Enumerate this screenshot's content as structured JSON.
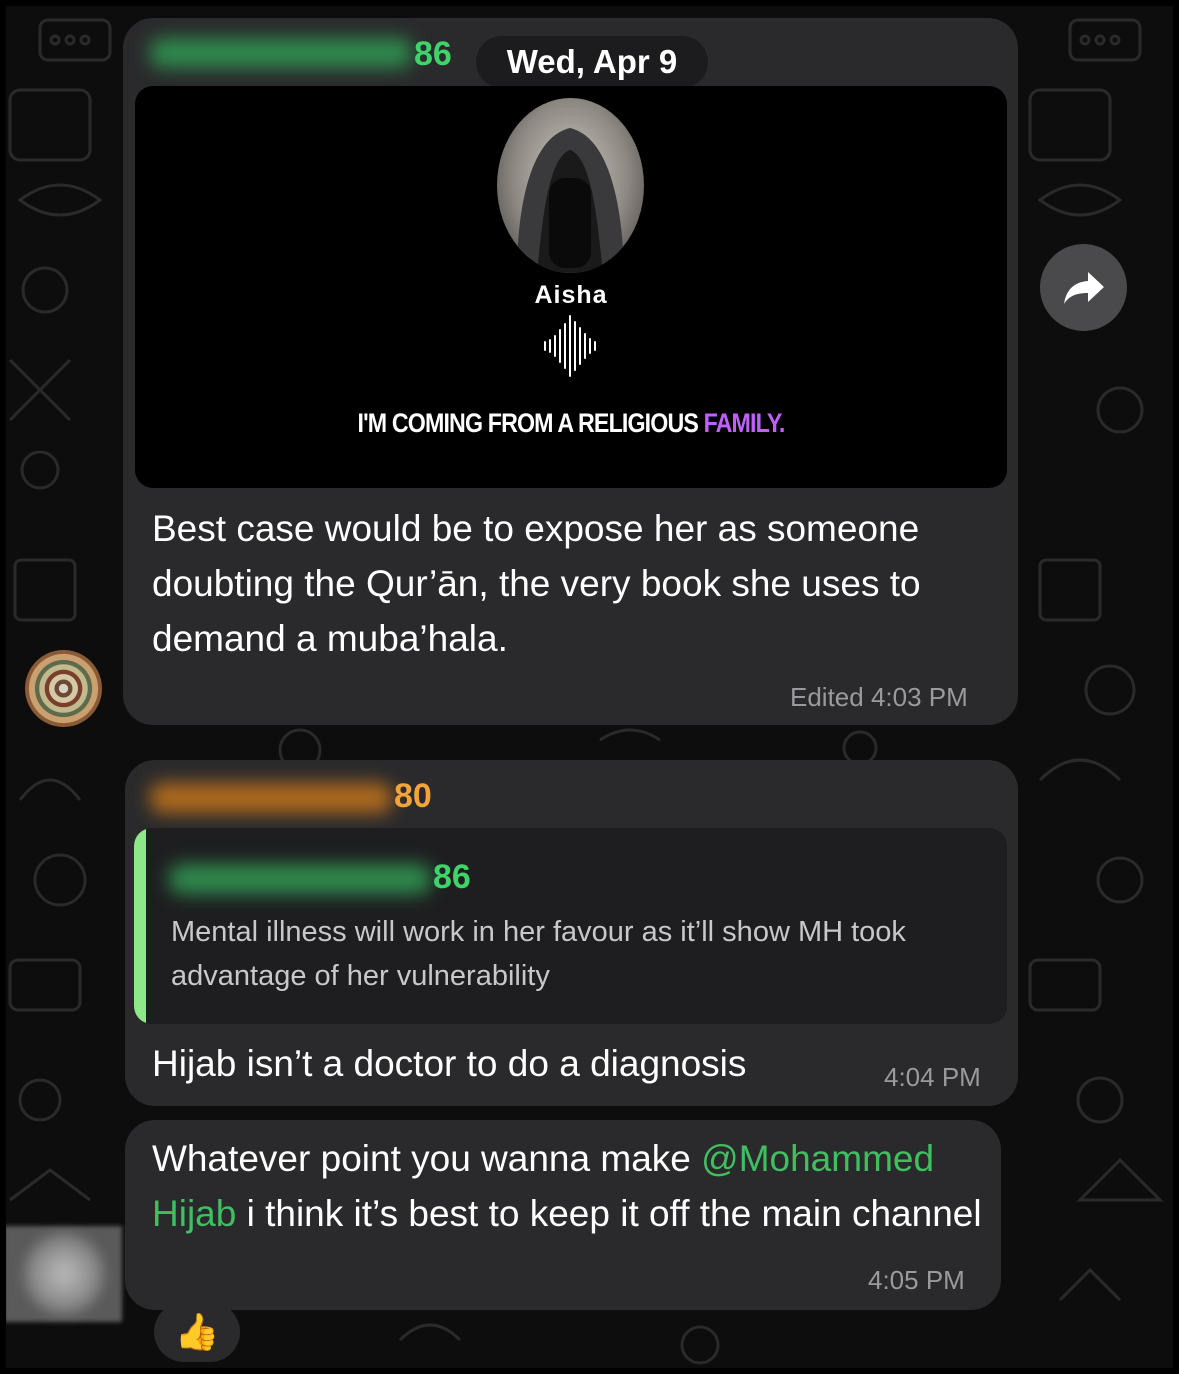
{
  "date_separator": "Wed, Apr 9",
  "messages": [
    {
      "sender_suffix": "86",
      "media": {
        "name": "Aisha",
        "caption_main": "I'M COMING FROM A RELIGIOUS ",
        "caption_highlight": "FAMILY."
      },
      "text": "Best case would be to expose her as someone doubting the Qur’ān, the very book she uses to demand a muba’hala.",
      "edited_label": "Edited",
      "time": "4:03 PM"
    },
    {
      "sender_suffix": "80",
      "reply": {
        "sender_suffix": "86",
        "text": "Mental illness will work in her favour as it’ll show MH took advantage of her vulnerability"
      },
      "text": "Hijab isn’t a doctor to do a diagnosis",
      "time": "4:04 PM"
    },
    {
      "text_before": "Whatever point you wanna make",
      "mention": "@Mohammed Hijab",
      "text_after": " i think it’s best to keep it off the main channel",
      "time": "4:05 PM",
      "reaction": "👍"
    }
  ],
  "colors": {
    "sender_green": "#3fd36a",
    "sender_orange": "#f2a33a",
    "reply_bar": "#8de88a",
    "mention": "#3fbf5f",
    "highlight_purple": "#c060ff"
  },
  "icons": {
    "forward": "forward-arrow-icon",
    "reaction": "thumbs-up-icon"
  }
}
